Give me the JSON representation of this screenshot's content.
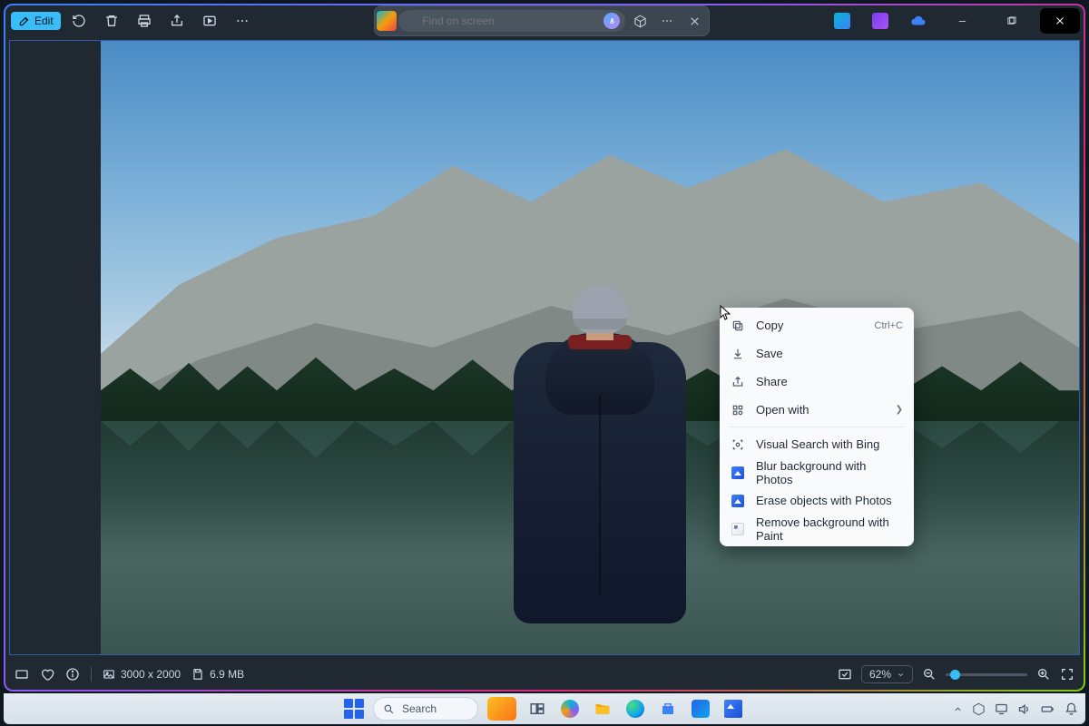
{
  "toolbar": {
    "edit_label": "Edit",
    "search_placeholder": "Find on screen"
  },
  "context_menu": {
    "copy": "Copy",
    "copy_accel": "Ctrl+C",
    "save": "Save",
    "share": "Share",
    "open_with": "Open with",
    "visual_search": "Visual Search with Bing",
    "blur_bg": "Blur background with Photos",
    "erase_obj": "Erase objects with Photos",
    "remove_bg": "Remove background with Paint"
  },
  "statusbar": {
    "dimensions": "3000 x 2000",
    "filesize": "6.9 MB",
    "zoom": "62%"
  },
  "taskbar": {
    "search_label": "Search"
  }
}
